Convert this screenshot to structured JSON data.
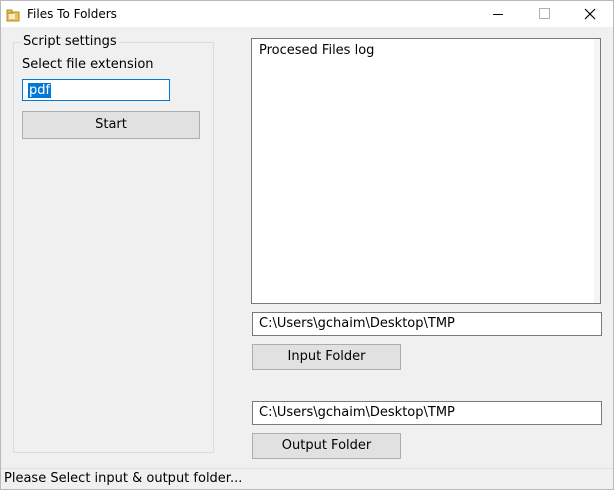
{
  "window": {
    "title": "Files To Folders"
  },
  "settings": {
    "group_label": "Script settings",
    "extension_label": "Select file extension",
    "extension_value": "pdf",
    "start_label": "Start"
  },
  "log": {
    "title": "Procesed Files log"
  },
  "input": {
    "path": "C:\\Users\\gchaim\\Desktop\\TMP",
    "button_label": "Input Folder"
  },
  "output": {
    "path": "C:\\Users\\gchaim\\Desktop\\TMP",
    "button_label": "Output Folder"
  },
  "status": {
    "text": "Please Select input & output folder..."
  },
  "icons": {
    "app": "folder-icon",
    "minimize": "minimize-icon",
    "maximize": "maximize-icon",
    "close": "close-icon"
  },
  "colors": {
    "selection": "#0078d7",
    "window_bg": "#f0f0f0",
    "button_bg": "#e1e1e1"
  }
}
